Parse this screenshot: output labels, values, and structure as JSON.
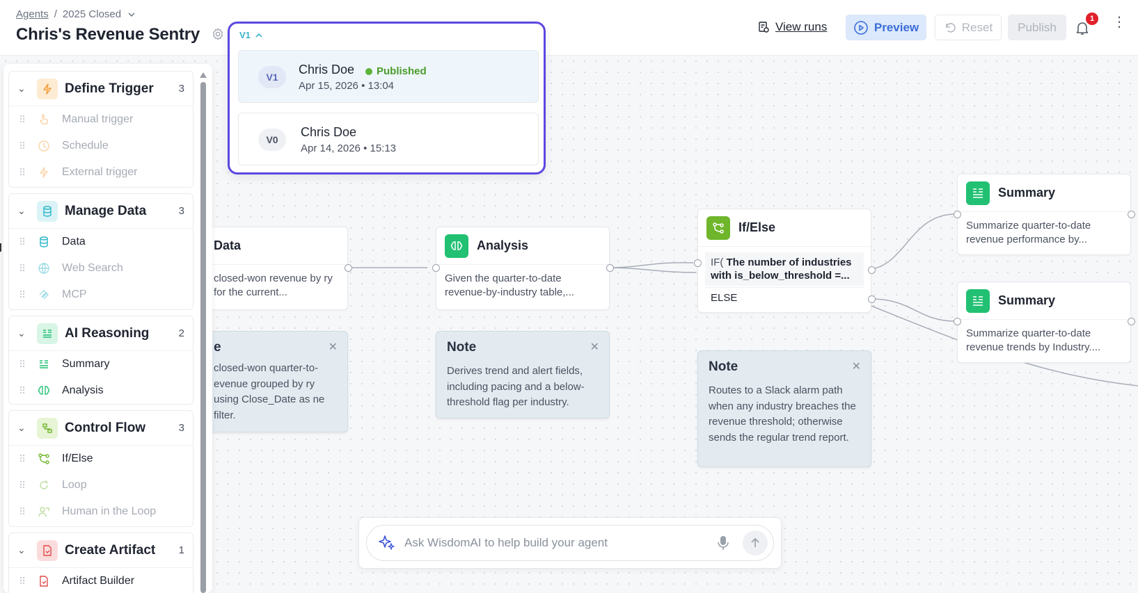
{
  "header": {
    "breadcrumb_root": "Agents",
    "breadcrumb_current": "2025 Closed",
    "title": "Chris's Revenue Sentry",
    "view_runs_label": "View runs",
    "preview_label": "Preview",
    "reset_label": "Reset",
    "publish_label": "Publish",
    "notification_count": "1"
  },
  "versions": {
    "toggle_label": "V1",
    "items": [
      {
        "badge": "V1",
        "author": "Chris Doe",
        "status": "Published",
        "date": "Apr 15, 2026 • 13:04"
      },
      {
        "badge": "V0",
        "author": "Chris Doe",
        "status": "",
        "date": "Apr 14, 2026 • 15:13"
      }
    ]
  },
  "sidebar": {
    "groups": [
      {
        "title": "Define Trigger",
        "count": "3",
        "icon": "bolt-icon",
        "color": "#f59e3b",
        "items": [
          {
            "label": "Manual trigger",
            "icon": "hand-pointer-icon"
          },
          {
            "label": "Schedule",
            "icon": "clock-icon"
          },
          {
            "label": "External trigger",
            "icon": "bolt-icon"
          }
        ]
      },
      {
        "title": "Manage Data",
        "count": "3",
        "icon": "database-icon",
        "color": "#2bb5c9",
        "items": [
          {
            "label": "Data",
            "icon": "database-icon"
          },
          {
            "label": "Web Search",
            "icon": "globe-icon"
          },
          {
            "label": "MCP",
            "icon": "mcp-icon"
          }
        ]
      },
      {
        "title": "AI Reasoning",
        "count": "2",
        "icon": "list-ai-icon",
        "color": "#22c073",
        "items": [
          {
            "label": "Summary",
            "icon": "list-ai-icon"
          },
          {
            "label": "Analysis",
            "icon": "brain-icon"
          }
        ]
      },
      {
        "title": "Control Flow",
        "count": "3",
        "icon": "branch-icon",
        "color": "#6fb62c",
        "items": [
          {
            "label": "If/Else",
            "icon": "branch-icon"
          },
          {
            "label": "Loop",
            "icon": "loop-icon"
          },
          {
            "label": "Human in the Loop",
            "icon": "human-icon"
          }
        ]
      },
      {
        "title": "Create Artifact",
        "count": "1",
        "icon": "file-icon",
        "color": "#e14b4b",
        "items": [
          {
            "label": "Artifact Builder",
            "icon": "file-icon"
          }
        ]
      }
    ]
  },
  "nodes": {
    "data": {
      "title": "Data",
      "body": "closed-won revenue by ry for the current..."
    },
    "analysis": {
      "title": "Analysis",
      "body": "Given the quarter-to-date revenue-by-industry table,..."
    },
    "ifelse": {
      "title": "If/Else",
      "if_label": "IF(",
      "if_text": "The number of industries with is_below_threshold =...",
      "else_label": "ELSE"
    },
    "summary1": {
      "title": "Summary",
      "body": "Summarize quarter-to-date revenue performance by..."
    },
    "summary2": {
      "title": "Summary",
      "body": "Summarize quarter-to-date revenue trends by Industry...."
    }
  },
  "notes": {
    "note1": {
      "title": "e",
      "body": "closed-won quarter-to- evenue grouped by ry using Close_Date as ne filter."
    },
    "note2": {
      "title": "Note",
      "body": "Derives trend and alert fields, including pacing and a below-threshold flag per industry."
    },
    "note3": {
      "title": "Note",
      "body": "Routes to a Slack alarm path when any industry breaches the revenue threshold; otherwise sends the regular trend report."
    }
  },
  "ask": {
    "placeholder": "Ask WisdomAI to help build your agent"
  },
  "colors": {
    "accent_blue": "#3b6fd8",
    "popover_border": "#5b47e0",
    "published_green": "#4a9c2a"
  }
}
